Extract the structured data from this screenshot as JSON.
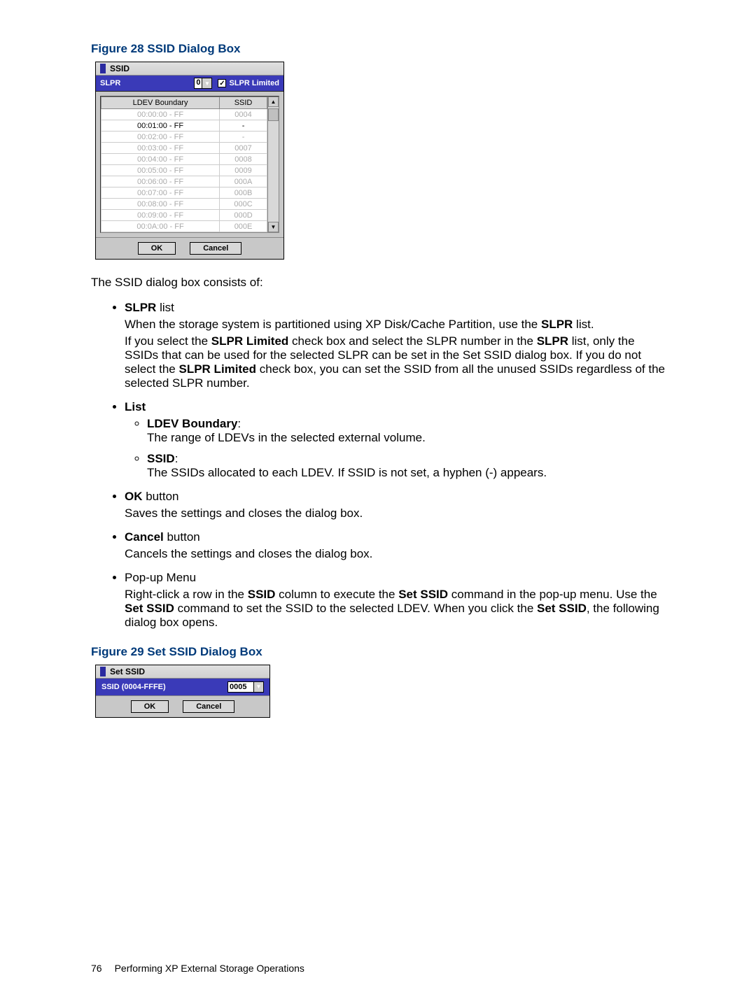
{
  "figure28": {
    "caption": "Figure 28 SSID Dialog Box"
  },
  "ssid_dialog": {
    "title": "SSID",
    "slpr_label": "SLPR",
    "slpr_value": "0",
    "slpr_limited_label": "SLPR Limited",
    "slpr_limited_checked": true,
    "col_ldev": "LDEV Boundary",
    "col_ssid": "SSID",
    "rows": [
      {
        "ldev": "00:00:00 - FF",
        "ssid": "0004",
        "active": false
      },
      {
        "ldev": "00:01:00 - FF",
        "ssid": "-",
        "active": true
      },
      {
        "ldev": "00:02:00 - FF",
        "ssid": "-",
        "active": false
      },
      {
        "ldev": "00:03:00 - FF",
        "ssid": "0007",
        "active": false
      },
      {
        "ldev": "00:04:00 - FF",
        "ssid": "0008",
        "active": false
      },
      {
        "ldev": "00:05:00 - FF",
        "ssid": "0009",
        "active": false
      },
      {
        "ldev": "00:06:00 - FF",
        "ssid": "000A",
        "active": false
      },
      {
        "ldev": "00:07:00 - FF",
        "ssid": "000B",
        "active": false
      },
      {
        "ldev": "00:08:00 - FF",
        "ssid": "000C",
        "active": false
      },
      {
        "ldev": "00:09:00 - FF",
        "ssid": "000D",
        "active": false
      },
      {
        "ldev": "00:0A:00 - FF",
        "ssid": "000E",
        "active": false
      }
    ],
    "ok": "OK",
    "cancel": "Cancel"
  },
  "intro": "The SSID dialog box consists of:",
  "bullets": {
    "slpr_title_b": "SLPR",
    "slpr_title_r": " list",
    "slpr_p1a": "When the storage system is partitioned using XP Disk/Cache Partition, use the ",
    "slpr_p1b": "SLPR",
    "slpr_p1c": " list.",
    "slpr_p2a": "If you select the ",
    "slpr_p2b": "SLPR Limited",
    "slpr_p2c": " check box and select the SLPR number in the ",
    "slpr_p2d": "SLPR",
    "slpr_p2e": " list, only the SSIDs that can be used for the selected SLPR can be set in the Set SSID dialog box. If you do not select the ",
    "slpr_p2f": "SLPR Limited",
    "slpr_p2g": " check box, you can set the SSID from all the unused SSIDs regardless of the selected SLPR number.",
    "list_title": "List",
    "ldev_b": "LDEV Boundary",
    "ldev_desc": "The range of LDEVs in the selected external volume.",
    "ssid_b": "SSID",
    "ssid_desc": "The SSIDs allocated to each LDEV. If SSID is not set, a hyphen (-) appears.",
    "ok_b": "OK",
    "ok_r": " button",
    "ok_desc": "Saves the settings and closes the dialog box.",
    "cancel_b": "Cancel",
    "cancel_r": " button",
    "cancel_desc": "Cancels the settings and closes the dialog box.",
    "popup_title": "Pop-up Menu",
    "popup_a": "Right-click a row in the ",
    "popup_b": "SSID",
    "popup_c": " column to execute the ",
    "popup_d": "Set SSID",
    "popup_e": " command in the pop-up menu. Use the ",
    "popup_f": "Set SSID",
    "popup_g": " command to set the SSID to the selected LDEV. When you click the ",
    "popup_h": "Set SSID",
    "popup_i": ", the following dialog box opens."
  },
  "figure29": {
    "caption": "Figure 29 Set SSID Dialog Box"
  },
  "set_dialog": {
    "title": "Set SSID",
    "label": "SSID (0004-FFFE)",
    "value": "0005",
    "ok": "OK",
    "cancel": "Cancel"
  },
  "footer": {
    "page": "76",
    "section": "Performing XP External Storage Operations"
  }
}
